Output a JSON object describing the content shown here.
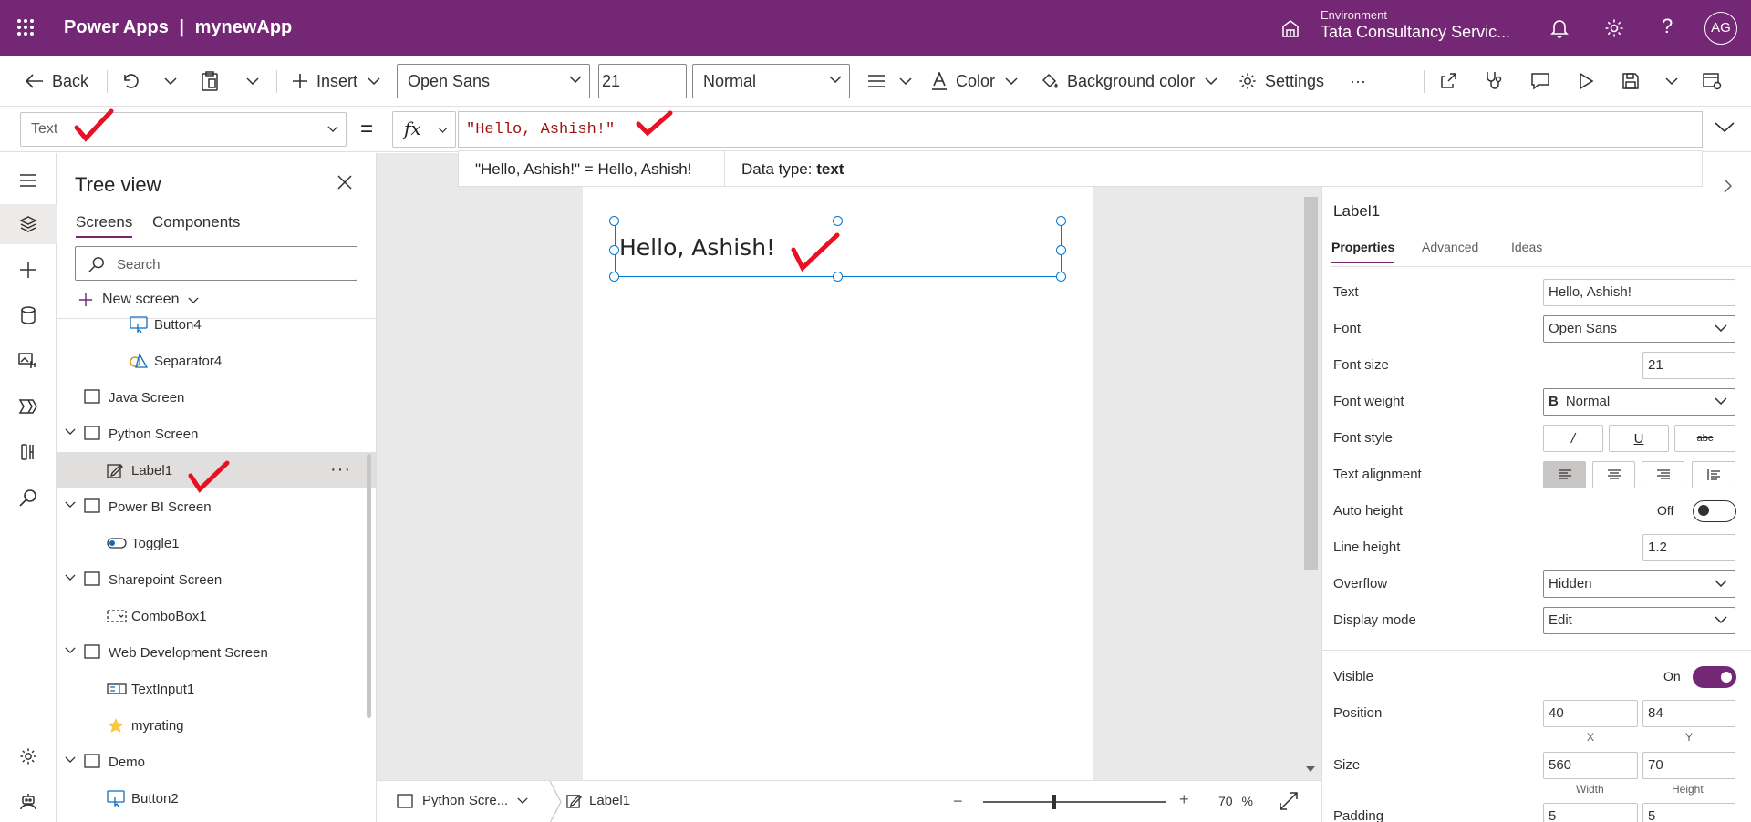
{
  "app": {
    "brand": "Power Apps",
    "separator": "|",
    "app_name": "mynewApp"
  },
  "environment": {
    "label": "Environment",
    "name": "Tata Consultancy Servic..."
  },
  "user": {
    "initials": "AG"
  },
  "colors": {
    "brand": "#742774",
    "selection": "#0078d4",
    "toggle_on": "#742774"
  },
  "commandbar": {
    "back": "Back",
    "insert": "Insert",
    "font": "Open Sans",
    "font_size": "21",
    "font_weight": "Normal",
    "color": "Color",
    "background_color": "Background color",
    "settings": "Settings",
    "more": "···"
  },
  "formula": {
    "property": "Text",
    "equals": "=",
    "fx": "fx",
    "value": "\"Hello, Ashish!\"",
    "hint_expr": "\"Hello, Ashish!\"  =  Hello, Ashish!",
    "hint_type_label": "Data type:",
    "hint_type_value": "text"
  },
  "tree": {
    "title": "Tree view",
    "tabs": [
      "Screens",
      "Components"
    ],
    "search_placeholder": "Search",
    "new_screen": "New screen",
    "items": [
      {
        "label": "Button4",
        "type": "button",
        "level": 2
      },
      {
        "label": "Separator4",
        "type": "shapes",
        "level": 2
      },
      {
        "label": "Java Screen",
        "type": "screen",
        "level": 1
      },
      {
        "label": "Python Screen",
        "type": "screen",
        "level": 1,
        "expanded": true
      },
      {
        "label": "Label1",
        "type": "label",
        "level": 2,
        "selected": true
      },
      {
        "label": "Power BI Screen",
        "type": "screen",
        "level": 1,
        "expanded": true
      },
      {
        "label": "Toggle1",
        "type": "toggle",
        "level": 2
      },
      {
        "label": "Sharepoint Screen",
        "type": "screen",
        "level": 1,
        "expanded": true
      },
      {
        "label": "ComboBox1",
        "type": "combobox",
        "level": 2
      },
      {
        "label": "Web Development Screen",
        "type": "screen",
        "level": 1,
        "expanded": true
      },
      {
        "label": "TextInput1",
        "type": "textinput",
        "level": 2
      },
      {
        "label": "myrating",
        "type": "rating",
        "level": 2
      },
      {
        "label": "Demo",
        "type": "screen",
        "level": 1,
        "expanded": true
      },
      {
        "label": "Button2",
        "type": "button",
        "level": 2
      }
    ]
  },
  "canvas": {
    "label_text": "Hello, Ashish!"
  },
  "statusbar": {
    "screen": "Python Scre...",
    "control": "Label1",
    "zoom": "70",
    "zoom_unit": "%",
    "zoom_level_pct": 38
  },
  "properties": {
    "control_type": "Label",
    "name": "Label1",
    "tabs": [
      "Properties",
      "Advanced",
      "Ideas"
    ],
    "text_label": "Text",
    "text_value": "Hello, Ashish!",
    "font_label": "Font",
    "font_value": "Open Sans",
    "font_size_label": "Font size",
    "font_size_value": "21",
    "font_weight_label": "Font weight",
    "font_weight_icon": "B",
    "font_weight_value": "Normal",
    "font_style_label": "Font style",
    "italic": "/",
    "underline": "U",
    "strike": "abc",
    "alignment_label": "Text alignment",
    "auto_height_label": "Auto height",
    "auto_height_state": "Off",
    "line_height_label": "Line height",
    "line_height_value": "1.2",
    "overflow_label": "Overflow",
    "overflow_value": "Hidden",
    "display_mode_label": "Display mode",
    "display_mode_value": "Edit",
    "visible_label": "Visible",
    "visible_state": "On",
    "position_label": "Position",
    "x_value": "40",
    "y_value": "84",
    "x_cap": "X",
    "y_cap": "Y",
    "size_label": "Size",
    "width_value": "560",
    "height_value": "70",
    "width_cap": "Width",
    "height_cap": "Height",
    "padding_label": "Padding",
    "padding_top": "5",
    "padding_bottom": "5"
  }
}
